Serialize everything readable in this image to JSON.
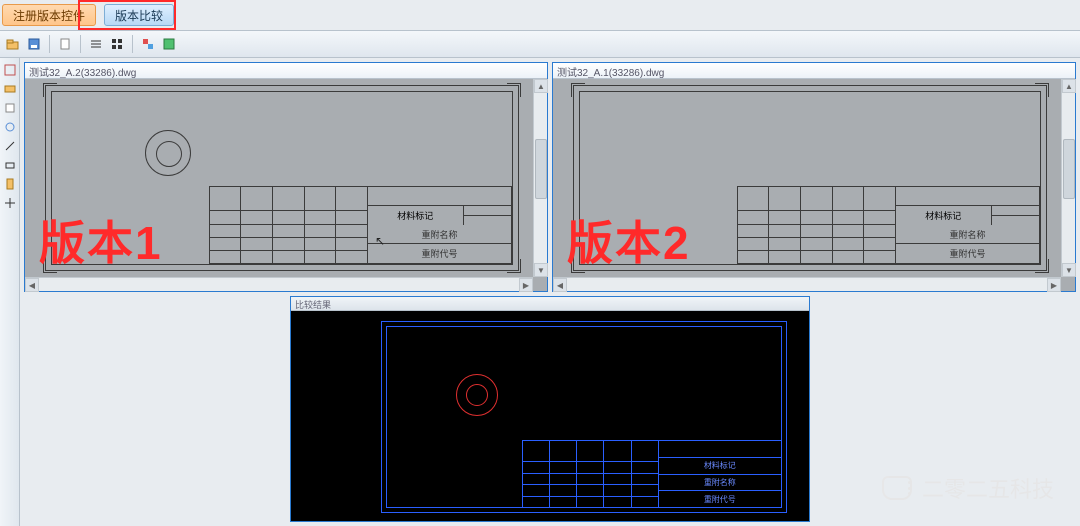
{
  "buttons": {
    "register_control": "注册版本控件",
    "compare": "版本比较"
  },
  "panes": {
    "left_title": "测试32_A.2(33286).dwg",
    "right_title": "测试32_A.1(33286).dwg",
    "left_overlay": "版本1",
    "right_overlay": "版本2"
  },
  "title_block": {
    "row1": "材料标记",
    "row2": "重附名称",
    "row3": "重附代号"
  },
  "result": {
    "title": "比较结果",
    "tb_row1": "材料标记",
    "tb_row2": "重附名称",
    "tb_row3": "重附代号"
  },
  "watermark": "二零二五科技"
}
